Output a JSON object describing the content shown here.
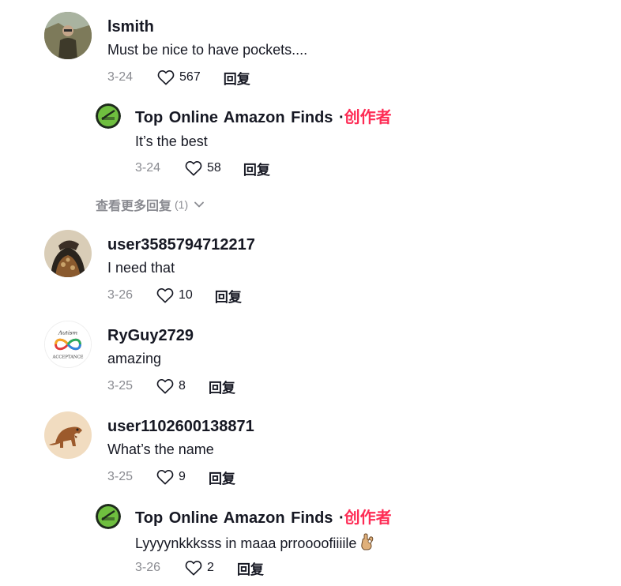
{
  "comments": [
    {
      "username": "lsmith",
      "text": "Must be nice to have pockets....",
      "date": "3-24",
      "likes": "567",
      "reply_label": "回复",
      "avatar": "avatar-photo-man-outdoors"
    },
    {
      "username": "user3585794712217",
      "text": "I need that",
      "date": "3-26",
      "likes": "10",
      "reply_label": "回复",
      "avatar": "avatar-photo-jacket"
    },
    {
      "username": "RyGuy2729",
      "text": "amazing",
      "date": "3-25",
      "likes": "8",
      "reply_label": "回复",
      "avatar": "avatar-autism-acceptance-logo",
      "avatar_text_top": "Autism",
      "avatar_text_bottom": "ACCEPTANCE"
    },
    {
      "username": "user1102600138871",
      "text": "What’s the name",
      "date": "3-25",
      "likes": "9",
      "reply_label": "回复",
      "avatar": "avatar-dinosaur"
    }
  ],
  "replies": [
    {
      "username": "Top  Online  Amazon  Finds",
      "dot": "·",
      "badge": "创作者",
      "text": "It’s the best",
      "date": "3-24",
      "likes": "58",
      "reply_label": "回复"
    },
    {
      "username": "Top  Online  Amazon  Finds",
      "dot": "·",
      "badge": "创作者",
      "text": "Lyyyynkkksss in maaa prroooofiiiile",
      "date": "3-26",
      "likes": "2",
      "reply_label": "回复",
      "emoji": "ok-hand-emoji"
    }
  ],
  "view_more": {
    "label": "查看更多回复",
    "count": "(1)"
  },
  "colors": {
    "creator_badge": "#fe2c55",
    "meta_gray": "#8a8b91",
    "text": "#161823"
  }
}
